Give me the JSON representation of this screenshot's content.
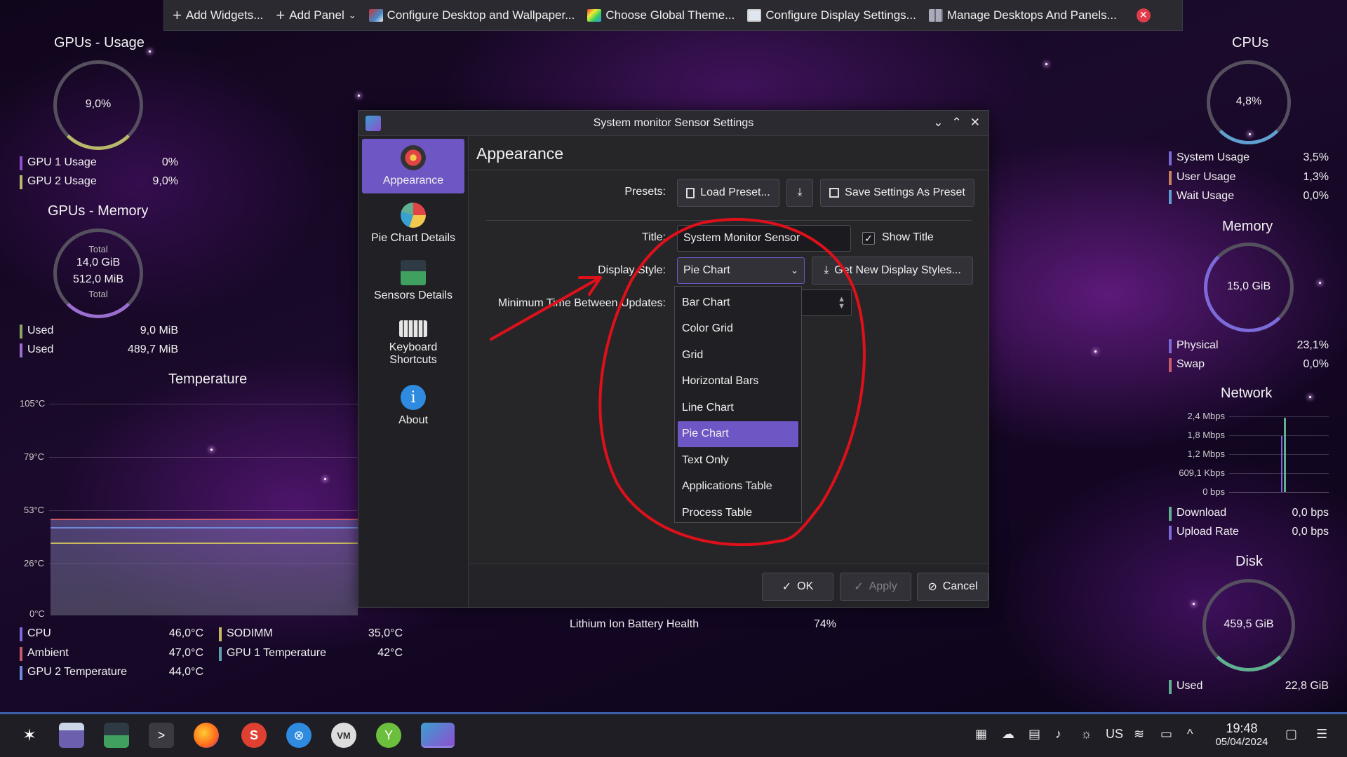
{
  "toolbar": {
    "add_widgets": "Add Widgets...",
    "add_panel": "Add Panel",
    "configure_desktop": "Configure Desktop and Wallpaper...",
    "global_theme": "Choose Global Theme...",
    "display_settings": "Configure Display Settings...",
    "manage_desktops": "Manage Desktops And Panels..."
  },
  "gpu_usage": {
    "title": "GPUs - Usage",
    "center": "9,0%",
    "rows": [
      {
        "label": "GPU 1 Usage",
        "value": "0%",
        "color": "#8e4fd0"
      },
      {
        "label": "GPU 2 Usage",
        "value": "9,0%",
        "color": "#b8b86a"
      }
    ]
  },
  "gpu_memory": {
    "title": "GPUs - Memory",
    "total_label_top": "Total",
    "total_value_1": "14,0 GiB",
    "total_value_2": "512,0 MiB",
    "total_label_bottom": "Total",
    "rows": [
      {
        "label": "Used",
        "value": "9,0 MiB",
        "color": "#8aa862"
      },
      {
        "label": "Used",
        "value": "489,7 MiB",
        "color": "#9b6ed0"
      }
    ]
  },
  "temperature": {
    "title": "Temperature",
    "ticks": [
      "105°C",
      "79°C",
      "53°C",
      "26°C",
      "0°C"
    ],
    "rows_left": [
      {
        "label": "CPU",
        "value": "46,0°C",
        "color": "#7b6bd8"
      },
      {
        "label": "Ambient",
        "value": "47,0°C",
        "color": "#c85c6a"
      },
      {
        "label": "GPU 2 Temperature",
        "value": "44,0°C",
        "color": "#6e8ad8"
      }
    ],
    "rows_right": [
      {
        "label": "SODIMM",
        "value": "35,0°C",
        "color": "#c8b860"
      },
      {
        "label": "GPU 1 Temperature",
        "value": "42°C",
        "color": "#5fa0b0"
      }
    ]
  },
  "battery": {
    "label": "Lithium Ion Battery Health",
    "value": "74%"
  },
  "cpus": {
    "title": "CPUs",
    "center": "4,8%",
    "rows": [
      {
        "label": "System Usage",
        "value": "3,5%",
        "color": "#7b6bd8"
      },
      {
        "label": "User Usage",
        "value": "1,3%",
        "color": "#c88060"
      },
      {
        "label": "Wait Usage",
        "value": "0,0%",
        "color": "#5fa0d0"
      }
    ]
  },
  "memory": {
    "title": "Memory",
    "center": "15,0 GiB",
    "rows": [
      {
        "label": "Physical",
        "value": "23,1%",
        "color": "#7b6bd8"
      },
      {
        "label": "Swap",
        "value": "0,0%",
        "color": "#c85c6a"
      }
    ]
  },
  "network": {
    "title": "Network",
    "ticks": [
      "2,4 Mbps",
      "1,8 Mbps",
      "1,2 Mbps",
      "609,1 Kbps",
      "0 bps"
    ],
    "rows": [
      {
        "label": "Download",
        "value": "0,0 bps",
        "color": "#5fb090"
      },
      {
        "label": "Upload Rate",
        "value": "0,0 bps",
        "color": "#7b6bd8"
      }
    ]
  },
  "disk": {
    "title": "Disk",
    "center": "459,5 GiB",
    "rows": [
      {
        "label": "Used",
        "value": "22,8 GiB",
        "color": "#5fb090"
      }
    ]
  },
  "dialog": {
    "title": "System monitor Sensor Settings",
    "sidebar": [
      {
        "label": "Appearance"
      },
      {
        "label": "Pie Chart Details"
      },
      {
        "label": "Sensors Details"
      },
      {
        "label": "Keyboard Shortcuts"
      },
      {
        "label": "About"
      }
    ],
    "page_title": "Appearance",
    "presets_label": "Presets:",
    "load_preset": "Load Preset...",
    "save_preset": "Save Settings As Preset",
    "title_label": "Title:",
    "title_value": "System Monitor Sensor",
    "show_title": "Show Title",
    "display_style_label": "Display Style:",
    "display_style_value": "Pie Chart",
    "get_new_styles": "Get New Display Styles...",
    "min_time_label": "Minimum Time Between Updates:",
    "dropdown": [
      "Bar Chart",
      "Color Grid",
      "Grid",
      "Horizontal Bars",
      "Line Chart",
      "Pie Chart",
      "Text Only",
      "Applications Table",
      "Process Table"
    ],
    "ok": "OK",
    "apply": "Apply",
    "cancel": "Cancel"
  },
  "taskbar": {
    "keyboard_layout": "US",
    "time": "19:48",
    "date": "05/04/2024"
  },
  "colors": {
    "accent": "#6e56c4",
    "annotation": "#e0101a"
  }
}
